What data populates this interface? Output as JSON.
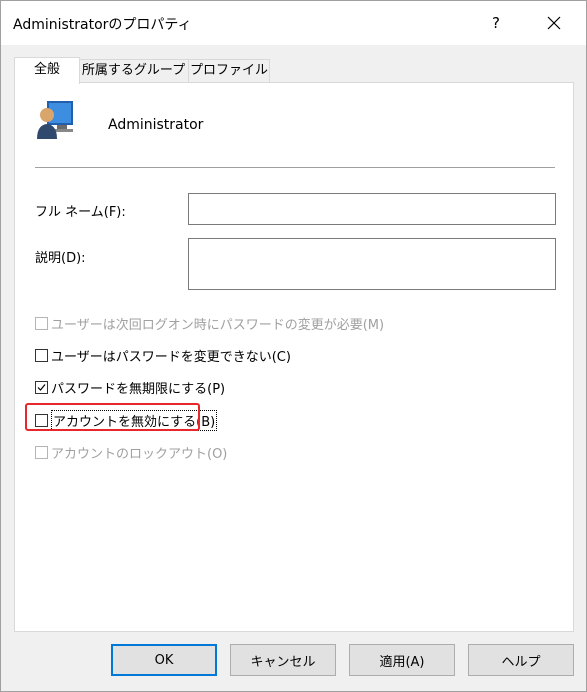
{
  "window": {
    "title": "Administratorのプロパティ",
    "help_label": "?"
  },
  "tabs": [
    {
      "label": "全般",
      "active": true
    },
    {
      "label": "所属するグループ",
      "active": false
    },
    {
      "label": "プロファイル",
      "active": false
    }
  ],
  "user": {
    "name": "Administrator",
    "icon": "user-account-icon"
  },
  "fields": {
    "full_name_label": "フル ネーム(F):",
    "full_name_value": "",
    "description_label": "説明(D):",
    "description_value": ""
  },
  "checkboxes": [
    {
      "label": "ユーザーは次回ログオン時にパスワードの変更が必要(M)",
      "checked": false,
      "enabled": false
    },
    {
      "label": "ユーザーはパスワードを変更できない(C)",
      "checked": false,
      "enabled": true
    },
    {
      "label": "パスワードを無期限にする(P)",
      "checked": true,
      "enabled": true
    },
    {
      "label": "アカウントを無効にする(B)",
      "checked": false,
      "enabled": true,
      "highlighted": true
    },
    {
      "label": "アカウントのロックアウト(O)",
      "checked": false,
      "enabled": false
    }
  ],
  "buttons": {
    "ok": "OK",
    "cancel": "キャンセル",
    "apply": "適用(A)",
    "help": "ヘルプ"
  },
  "colors": {
    "highlight": "#e8272c",
    "default_button_border": "#0078d7",
    "disabled_text": "#a0a0a0"
  }
}
